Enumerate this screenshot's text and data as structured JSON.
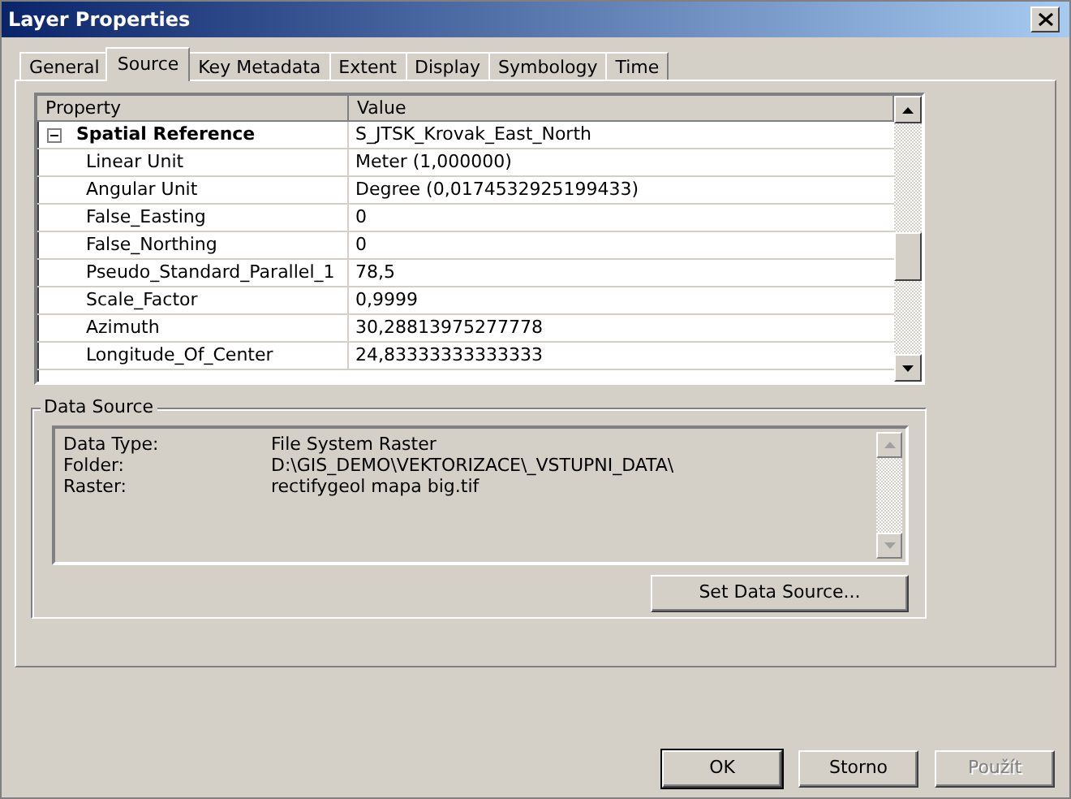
{
  "window": {
    "title": "Layer Properties"
  },
  "tabs": [
    {
      "label": "General",
      "selected": false
    },
    {
      "label": "Source",
      "selected": true
    },
    {
      "label": "Key Metadata",
      "selected": false
    },
    {
      "label": "Extent",
      "selected": false
    },
    {
      "label": "Display",
      "selected": false
    },
    {
      "label": "Symbology",
      "selected": false
    },
    {
      "label": "Time",
      "selected": false
    }
  ],
  "property_grid": {
    "columns": [
      "Property",
      "Value"
    ],
    "rows": [
      {
        "property": "Spatial Reference",
        "value": "S_JTSK_Krovak_East_North",
        "expanded": true,
        "children": [
          {
            "property": "Linear Unit",
            "value": "Meter (1,000000)"
          },
          {
            "property": "Angular Unit",
            "value": "Degree (0,0174532925199433)"
          },
          {
            "property": "False_Easting",
            "value": "0"
          },
          {
            "property": "False_Northing",
            "value": "0"
          },
          {
            "property": "Pseudo_Standard_Parallel_1",
            "value": "78,5"
          },
          {
            "property": "Scale_Factor",
            "value": "0,9999"
          },
          {
            "property": "Azimuth",
            "value": "30,28813975277778"
          },
          {
            "property": "Longitude_Of_Center",
            "value": "24,83333333333333"
          }
        ]
      }
    ]
  },
  "data_source": {
    "title": "Data Source",
    "entries": [
      {
        "label": "Data Type:",
        "value": "File System Raster"
      },
      {
        "label": "Folder:",
        "value": "D:\\GIS_DEMO\\VEKTORIZACE\\_VSTUPNI_DATA\\"
      },
      {
        "label": "Raster:",
        "value": "rectifygeol mapa big.tif"
      }
    ],
    "button": "Set Data Source..."
  },
  "buttons": [
    {
      "label": "OK",
      "disabled": false,
      "default": true
    },
    {
      "label": "Storno",
      "disabled": false,
      "default": false
    },
    {
      "label": "Použít",
      "disabled": true,
      "default": false
    }
  ]
}
